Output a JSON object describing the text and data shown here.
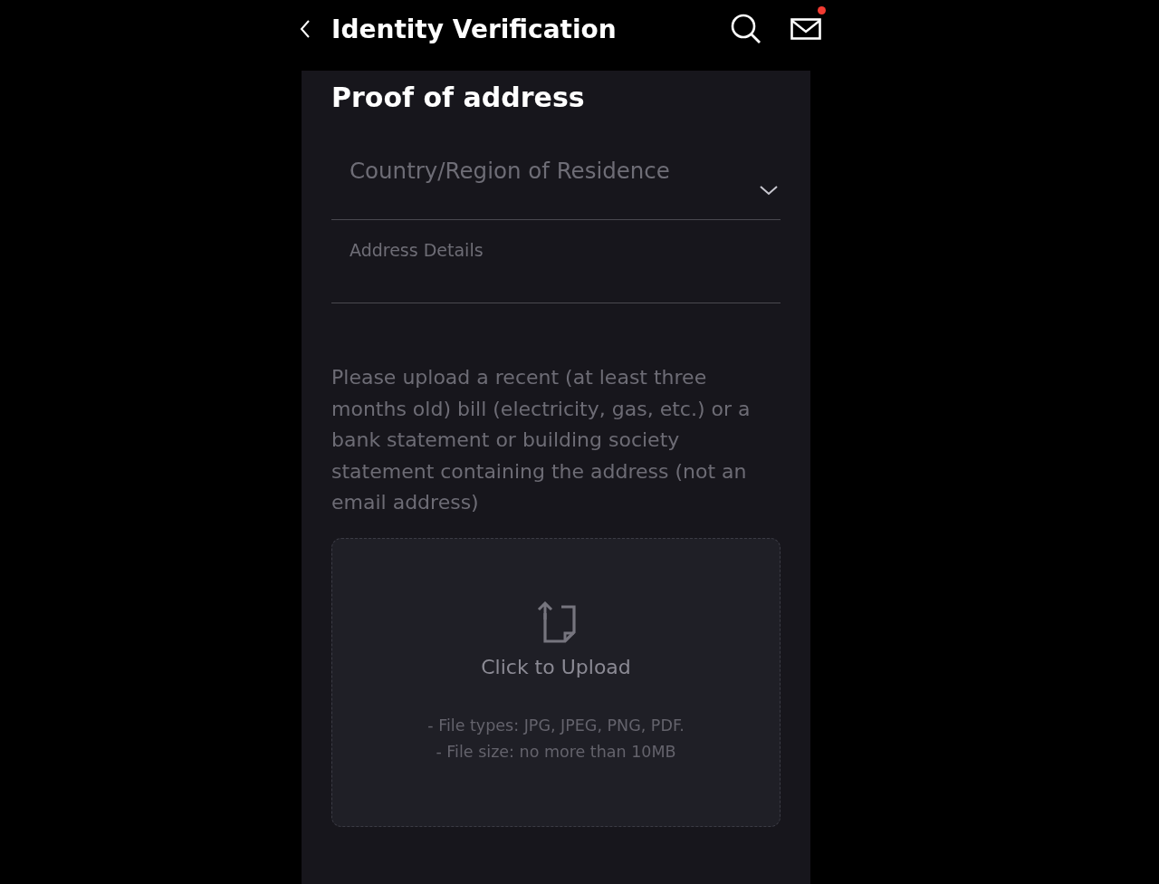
{
  "header": {
    "title": "Identity Verification",
    "unread": true
  },
  "section_title": "Proof of address",
  "fields": [
    {
      "kind": "dropdown",
      "placeholder": "Country/Region of Residence"
    },
    {
      "kind": "text",
      "placeholder": "Address Details"
    }
  ],
  "instructions": "Please upload a recent (at least three months old) bill (electricity, gas, etc.) or a bank statement or building society statement containing the address (not an email address)",
  "upload": {
    "label": "Click to Upload",
    "hints": [
      "- File types: JPG, JPEG, PNG, PDF.",
      "- File size: no more than 10MB"
    ]
  }
}
